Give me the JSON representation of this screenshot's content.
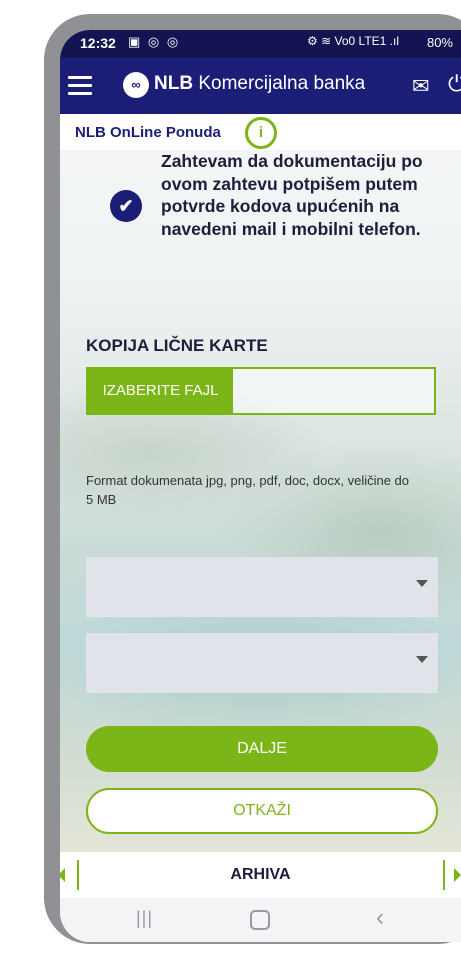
{
  "status_bar": {
    "time": "12:32",
    "icons": "▣ ◎ ◎",
    "network": "⚙ ≋ Vo0 LTE1 .ıl",
    "battery": "80%"
  },
  "app_bar": {
    "logo_mark": "∞",
    "brand_bold": "NLB",
    "brand_rest": " Komercijalna banka",
    "mail_icon": "✉",
    "power_icon": "⏻"
  },
  "sub_header": {
    "title": "NLB OnLine Ponuda",
    "info_icon": "i"
  },
  "form": {
    "consent_checked": true,
    "consent_text": "Zahtevam da dokumentaciju po ovom zahtevu potpišem putem potvrde kodova upućenih na navedeni mail i mobilni telefon.",
    "section_title": "KOPIJA LIČNE KARTE",
    "file_button": "IZABERITE FAJL",
    "file_value": "",
    "format_note": "Format dokumenata jpg, png, pdf, doc, docx, veličine do 5 MB",
    "select1_value": "",
    "select2_value": "",
    "continue_button": "DALJE",
    "cancel_button": "OTKAŽI"
  },
  "bottom_tab": {
    "label": "ARHIVA"
  },
  "colors": {
    "navy": "#1c1d76",
    "green": "#7cb518",
    "select_bg": "#e1e3ea"
  }
}
